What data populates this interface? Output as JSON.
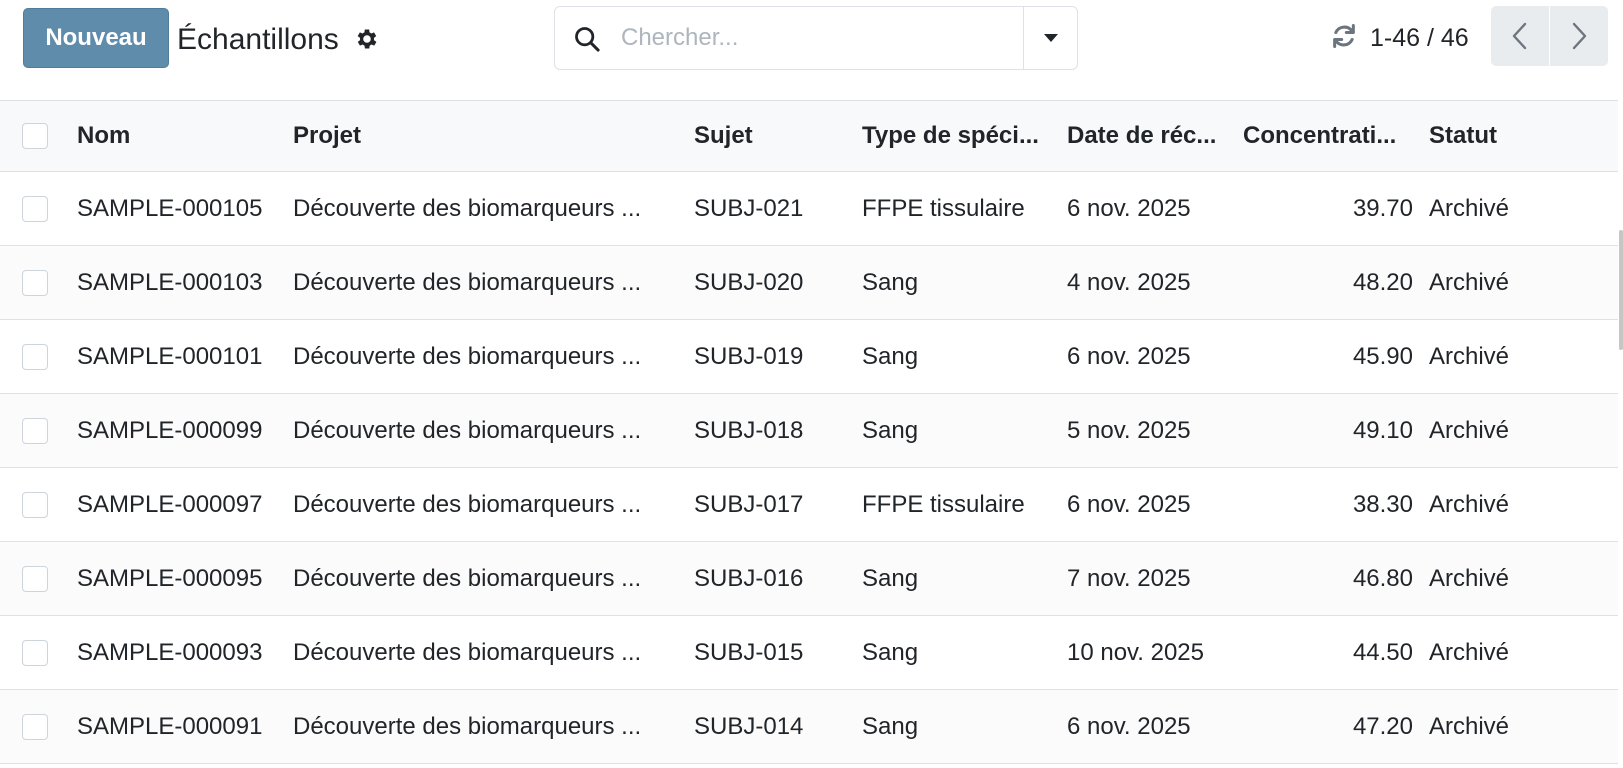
{
  "toolbar": {
    "new_label": "Nouveau",
    "title": "Échantillons",
    "search_placeholder": "Chercher...",
    "pager_value": "1-46 / 46"
  },
  "icons": {
    "gear": "gear-icon",
    "search": "search-icon",
    "dropdown": "caret-down-icon",
    "refresh": "refresh-icon",
    "prev": "chevron-left-icon",
    "next": "chevron-right-icon"
  },
  "colors": {
    "primary": "#5f8cab",
    "border": "#dee2e6",
    "header_bg": "#f8f9fa"
  },
  "table": {
    "columns": [
      "Nom",
      "Projet",
      "Sujet",
      "Type de spéci...",
      "Date de réc...",
      "Concentrati...",
      "Statut"
    ],
    "rows": [
      {
        "name": "SAMPLE-000105",
        "project": "Découverte des biomarqueurs ...",
        "subject": "SUBJ-021",
        "type": "FFPE tissulaire",
        "date": "6 nov. 2025",
        "conc": "39.70",
        "status": "Archivé"
      },
      {
        "name": "SAMPLE-000103",
        "project": "Découverte des biomarqueurs ...",
        "subject": "SUBJ-020",
        "type": "Sang",
        "date": "4 nov. 2025",
        "conc": "48.20",
        "status": "Archivé"
      },
      {
        "name": "SAMPLE-000101",
        "project": "Découverte des biomarqueurs ...",
        "subject": "SUBJ-019",
        "type": "Sang",
        "date": "6 nov. 2025",
        "conc": "45.90",
        "status": "Archivé"
      },
      {
        "name": "SAMPLE-000099",
        "project": "Découverte des biomarqueurs ...",
        "subject": "SUBJ-018",
        "type": "Sang",
        "date": "5 nov. 2025",
        "conc": "49.10",
        "status": "Archivé"
      },
      {
        "name": "SAMPLE-000097",
        "project": "Découverte des biomarqueurs ...",
        "subject": "SUBJ-017",
        "type": "FFPE tissulaire",
        "date": "6 nov. 2025",
        "conc": "38.30",
        "status": "Archivé"
      },
      {
        "name": "SAMPLE-000095",
        "project": "Découverte des biomarqueurs ...",
        "subject": "SUBJ-016",
        "type": "Sang",
        "date": "7 nov. 2025",
        "conc": "46.80",
        "status": "Archivé"
      },
      {
        "name": "SAMPLE-000093",
        "project": "Découverte des biomarqueurs ...",
        "subject": "SUBJ-015",
        "type": "Sang",
        "date": "10 nov. 2025",
        "conc": "44.50",
        "status": "Archivé"
      },
      {
        "name": "SAMPLE-000091",
        "project": "Découverte des biomarqueurs ...",
        "subject": "SUBJ-014",
        "type": "Sang",
        "date": "6 nov. 2025",
        "conc": "47.20",
        "status": "Archivé"
      }
    ]
  }
}
